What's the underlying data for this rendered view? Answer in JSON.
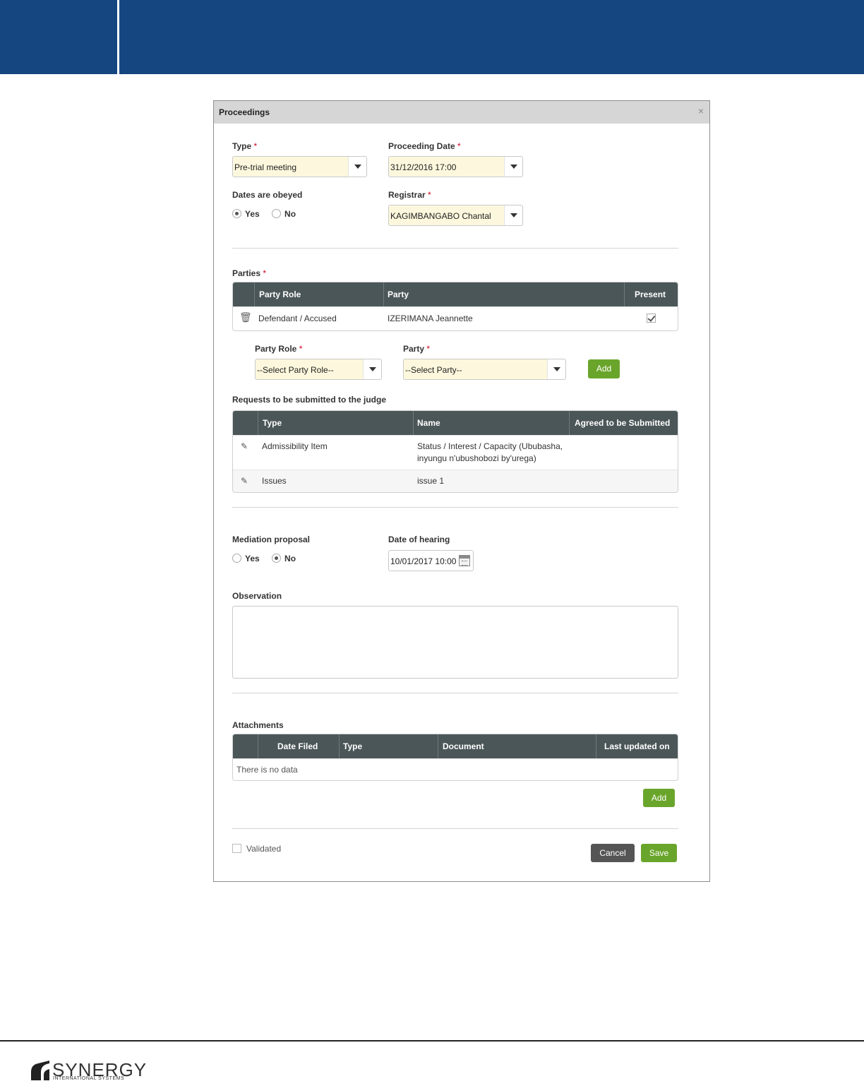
{
  "dialog": {
    "title": "Proceedings",
    "close_icon": "×"
  },
  "form": {
    "required_mark": "*",
    "type": {
      "label": "Type",
      "value": "Pre-trial meeting"
    },
    "proceeding_date": {
      "label": "Proceeding Date",
      "value": "31/12/2016 17:00"
    },
    "dates_obeyed": {
      "label": "Dates are obeyed",
      "yes": "Yes",
      "no": "No",
      "selected": "Yes"
    },
    "registrar": {
      "label": "Registrar",
      "value": "KAGIMBANGABO Chantal"
    },
    "mediation": {
      "label": "Mediation proposal",
      "yes": "Yes",
      "no": "No",
      "selected": "No"
    },
    "hearing_date": {
      "label": "Date of hearing",
      "value": "10/01/2017 10:00"
    },
    "observation": {
      "label": "Observation",
      "value": ""
    },
    "validated": {
      "label": "Validated",
      "checked": false
    }
  },
  "parties": {
    "label": "Parties",
    "columns": [
      "Party Role",
      "Party",
      "Present"
    ],
    "rows": [
      {
        "role": "Defendant / Accused",
        "party": "IZERIMANA Jeannette",
        "present": true
      }
    ],
    "new_role": {
      "label": "Party Role",
      "placeholder": "--Select Party Role--"
    },
    "new_party": {
      "label": "Party",
      "placeholder": "--Select Party--"
    },
    "add_label": "Add"
  },
  "requests": {
    "label": "Requests to be submitted to the judge",
    "columns": [
      "Type",
      "Name",
      "Agreed to be Submitted"
    ],
    "rows": [
      {
        "type": "Admissibility Item",
        "name_line1": "Status / Interest / Capacity (Ububasha,",
        "name_line2": "inyungu n'ubushobozi by'urega)",
        "agreed": ""
      },
      {
        "type": "Issues",
        "name_line1": "issue 1",
        "name_line2": "",
        "agreed": ""
      }
    ]
  },
  "attachments": {
    "label": "Attachments",
    "columns": [
      "Date Filed",
      "Type",
      "Document",
      "Last updated on"
    ],
    "empty_text": "There is no data",
    "add_label": "Add"
  },
  "actions": {
    "cancel_label": "Cancel",
    "save_label": "Save"
  },
  "branding": {
    "logo_word": "SYNERGY",
    "logo_sub": "INTERNATIONAL SYSTEMS"
  },
  "colors": {
    "banner": "#154680",
    "grid_header": "#4b5658",
    "accent_green": "#6aa52b",
    "input_fill": "#fdf8dd"
  }
}
